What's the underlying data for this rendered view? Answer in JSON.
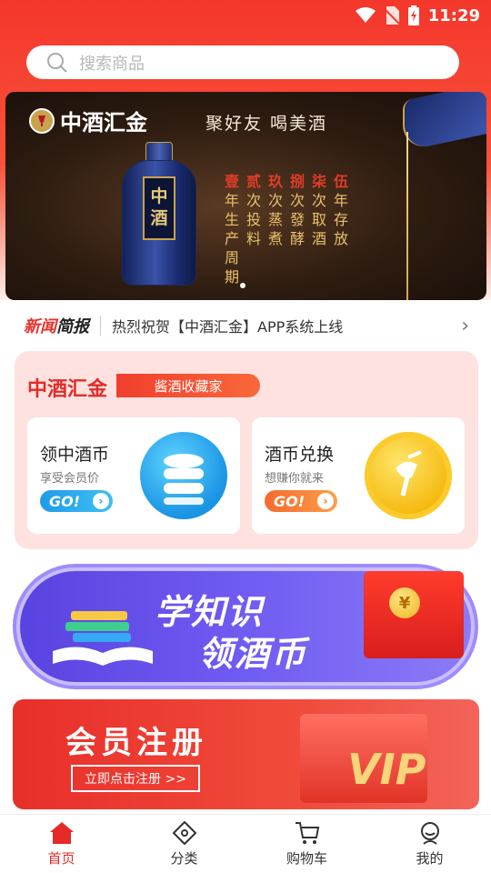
{
  "status_bar": {
    "time": "11:29"
  },
  "search": {
    "placeholder": "搜索商品"
  },
  "banner": {
    "brand": "中酒汇金",
    "slogan": "聚好友  喝美酒",
    "bottle_label": [
      "中",
      "酒"
    ],
    "poem": [
      {
        "head": "壹",
        "body": [
          "年",
          "生",
          "产",
          "周",
          "期"
        ]
      },
      {
        "head": "贰",
        "body": [
          "次",
          "投",
          "料"
        ]
      },
      {
        "head": "玖",
        "body": [
          "次",
          "蒸",
          "煮"
        ]
      },
      {
        "head": "捌",
        "body": [
          "次",
          "發",
          "酵"
        ]
      },
      {
        "head": "柒",
        "body": [
          "次",
          "取",
          "酒"
        ]
      },
      {
        "head": "伍",
        "body": [
          "年",
          "存",
          "放"
        ]
      }
    ]
  },
  "news": {
    "tag_red": "新闻",
    "tag_black": "简报",
    "text": "热烈祝贺【中酒汇金】APP系统上线"
  },
  "collect": {
    "title": "中酒汇金",
    "pill": "酱酒收藏家",
    "cards": [
      {
        "title": "领中酒币",
        "subtitle": "享受会员价",
        "go": "GO!"
      },
      {
        "title": "酒币兑换",
        "subtitle": "想赚你就来",
        "go": "GO!"
      }
    ]
  },
  "learn_banner": {
    "line1": "学知识",
    "line2": "领酒币"
  },
  "vip_banner": {
    "title": "会员注册",
    "button": "立即点击注册 >>",
    "vip": "VIP"
  },
  "tabbar": {
    "items": [
      {
        "label": "首页",
        "active": true
      },
      {
        "label": "分类",
        "active": false
      },
      {
        "label": "购物车",
        "active": false
      },
      {
        "label": "我的",
        "active": false
      }
    ]
  },
  "colors": {
    "primary": "#e42b27",
    "header": "#f4372b"
  }
}
